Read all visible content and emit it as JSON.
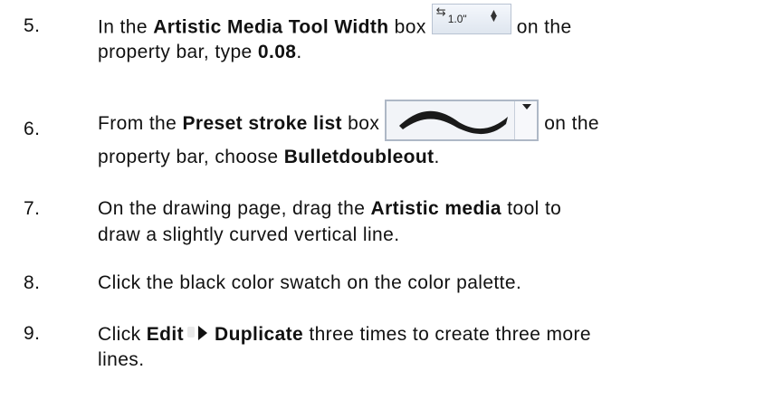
{
  "steps": [
    {
      "number": "5.",
      "parts": {
        "a": "In the ",
        "b": "Artistic Media Tool Width",
        "c": " box",
        "d": "on the",
        "e": "property bar, type ",
        "f": "0.08",
        "g": "."
      },
      "widget": {
        "value": "1.0\"",
        "icon": "spin-box-icon"
      }
    },
    {
      "number": "6.",
      "parts": {
        "a": "From the ",
        "b": "Preset stroke list",
        "c": " box",
        "d": "on the",
        "e": "property bar, choose ",
        "f": "Bulletdoubleout",
        "g": "."
      },
      "widget": {
        "icon": "preset-stroke-icon"
      }
    },
    {
      "number": "7.",
      "parts": {
        "a": "On the drawing page, drag the ",
        "b": "Artistic media",
        "c": " tool to",
        "d": "draw a slightly curved vertical line."
      }
    },
    {
      "number": "8.",
      "parts": {
        "a": "Click the black color swatch on the color palette."
      }
    },
    {
      "number": "9.",
      "parts": {
        "a": "Click ",
        "b": "Edit",
        "c": "Duplicate",
        "d": " three times to create three more",
        "e": "lines."
      },
      "widget": {
        "icon": "menu-arrow-icon"
      }
    }
  ]
}
